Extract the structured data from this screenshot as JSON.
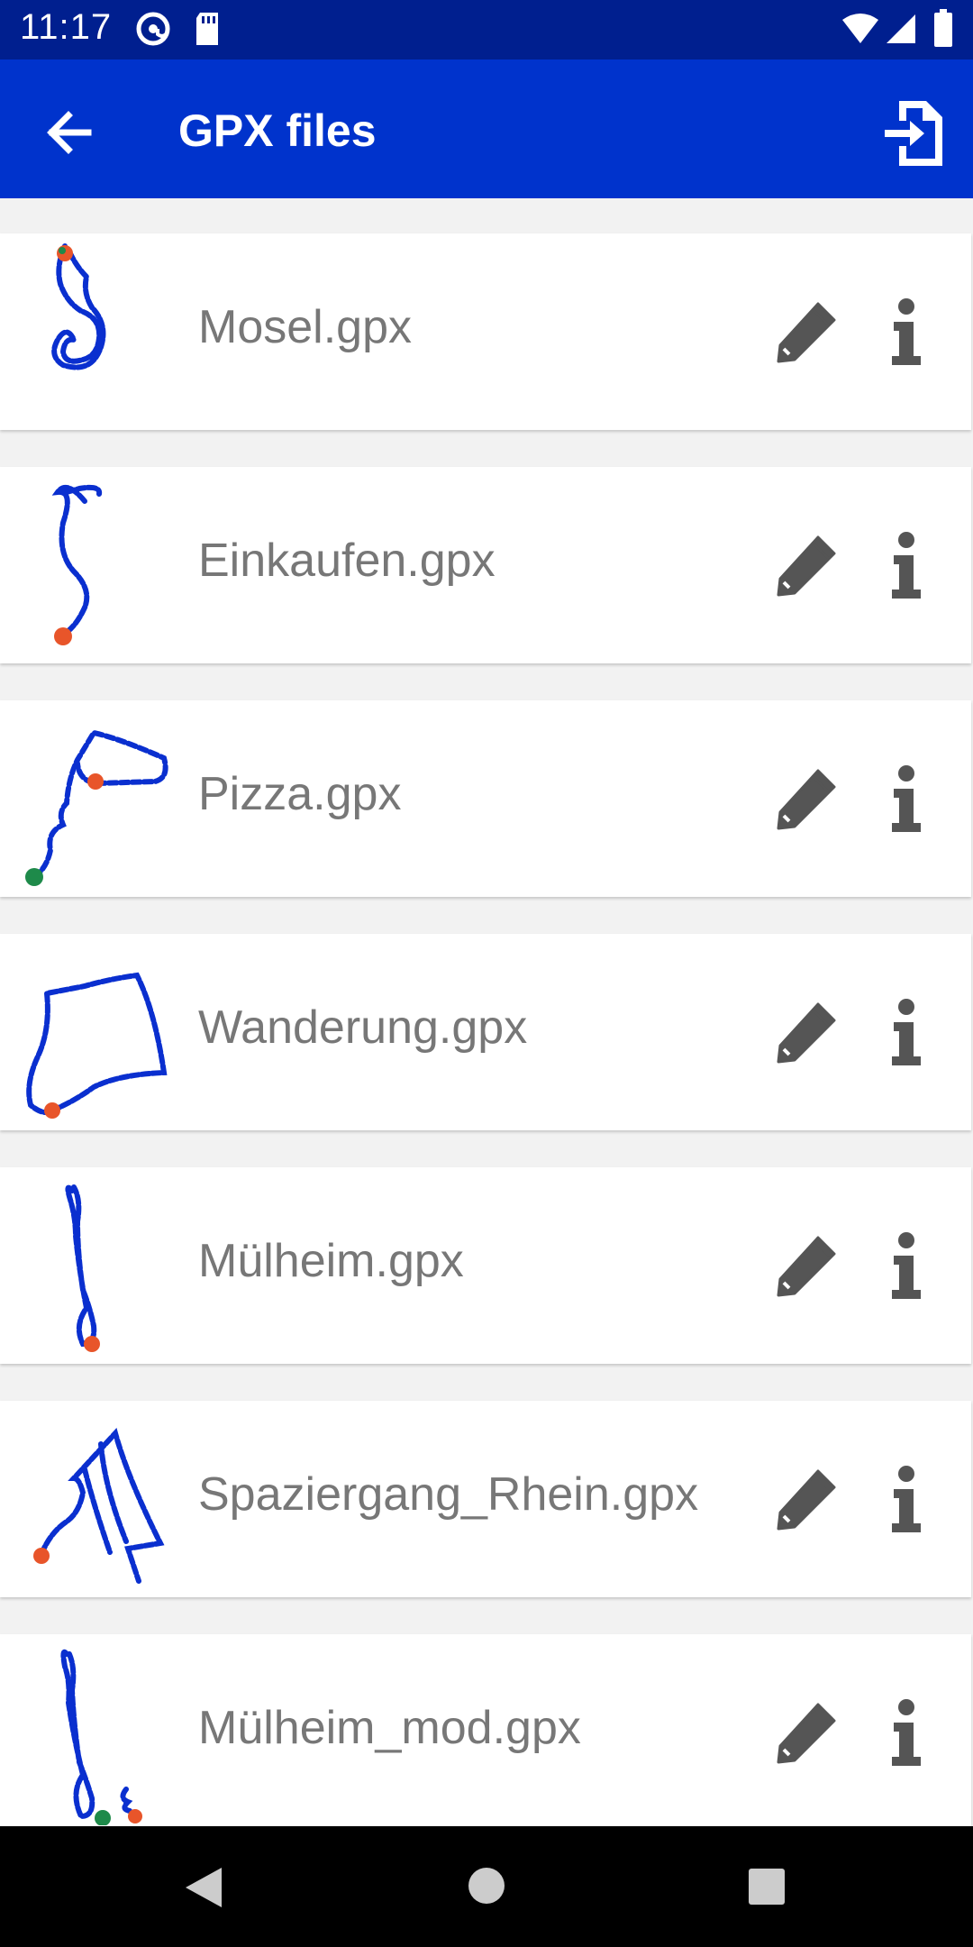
{
  "status_bar": {
    "time": "11:17",
    "icons": [
      "at-sign-icon",
      "sd-card-icon",
      "wifi-icon",
      "cell-signal-icon",
      "battery-icon"
    ]
  },
  "app_bar": {
    "title": "GPX files",
    "back_icon": "arrow-left-icon",
    "action_icon": "file-import-icon",
    "color": "#0033cc"
  },
  "files": [
    {
      "name": "Mosel.gpx"
    },
    {
      "name": "Einkaufen.gpx"
    },
    {
      "name": "Pizza.gpx"
    },
    {
      "name": "Wanderung.gpx"
    },
    {
      "name": "Mülheim.gpx"
    },
    {
      "name": "Spaziergang_Rhein.gpx"
    },
    {
      "name": "Mülheim_mod.gpx"
    }
  ],
  "row_actions": {
    "edit_icon": "pencil-icon",
    "info_icon": "info-icon"
  },
  "track_colors": {
    "track": "#0a2fcf",
    "start": "#1e8a4a",
    "end": "#e8552a"
  },
  "nav_bar": {
    "icons": [
      "back-triangle-icon",
      "home-circle-icon",
      "recents-square-icon"
    ]
  }
}
